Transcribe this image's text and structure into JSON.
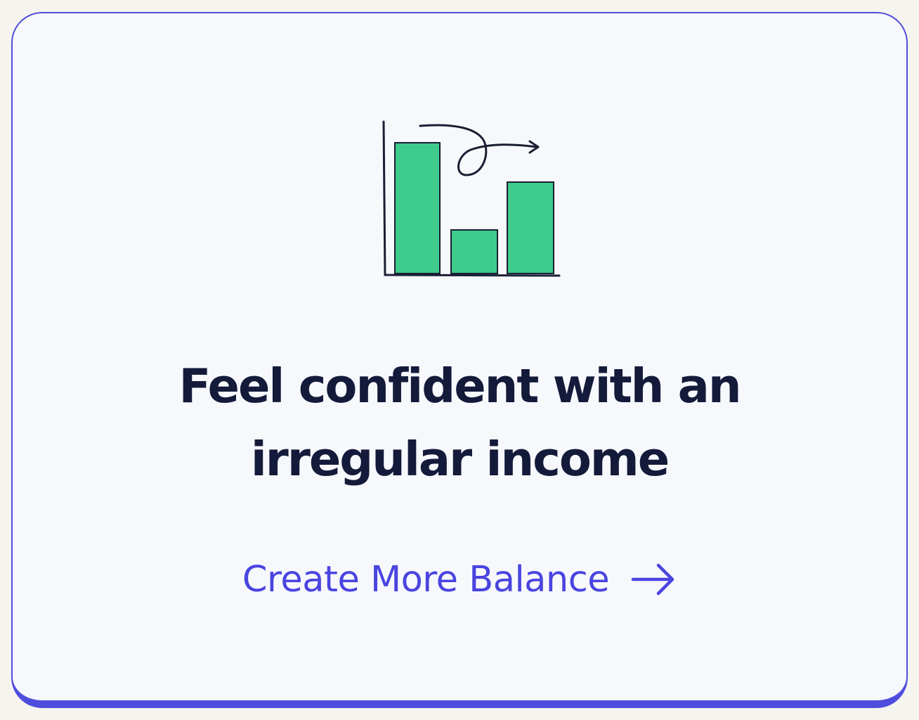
{
  "card": {
    "headline_line1": "Feel confident with an",
    "headline_line2": "irregular income",
    "cta_label": "Create More Balance",
    "cta_icon": "arrow-right-icon",
    "illustration_icon": "bar-chart-icon"
  },
  "colors": {
    "accent": "#4f4ddd",
    "link": "#4a44e0",
    "bar_fill": "#3ecb8c",
    "ink": "#141a3a",
    "card_background": "#f7f8fc"
  }
}
